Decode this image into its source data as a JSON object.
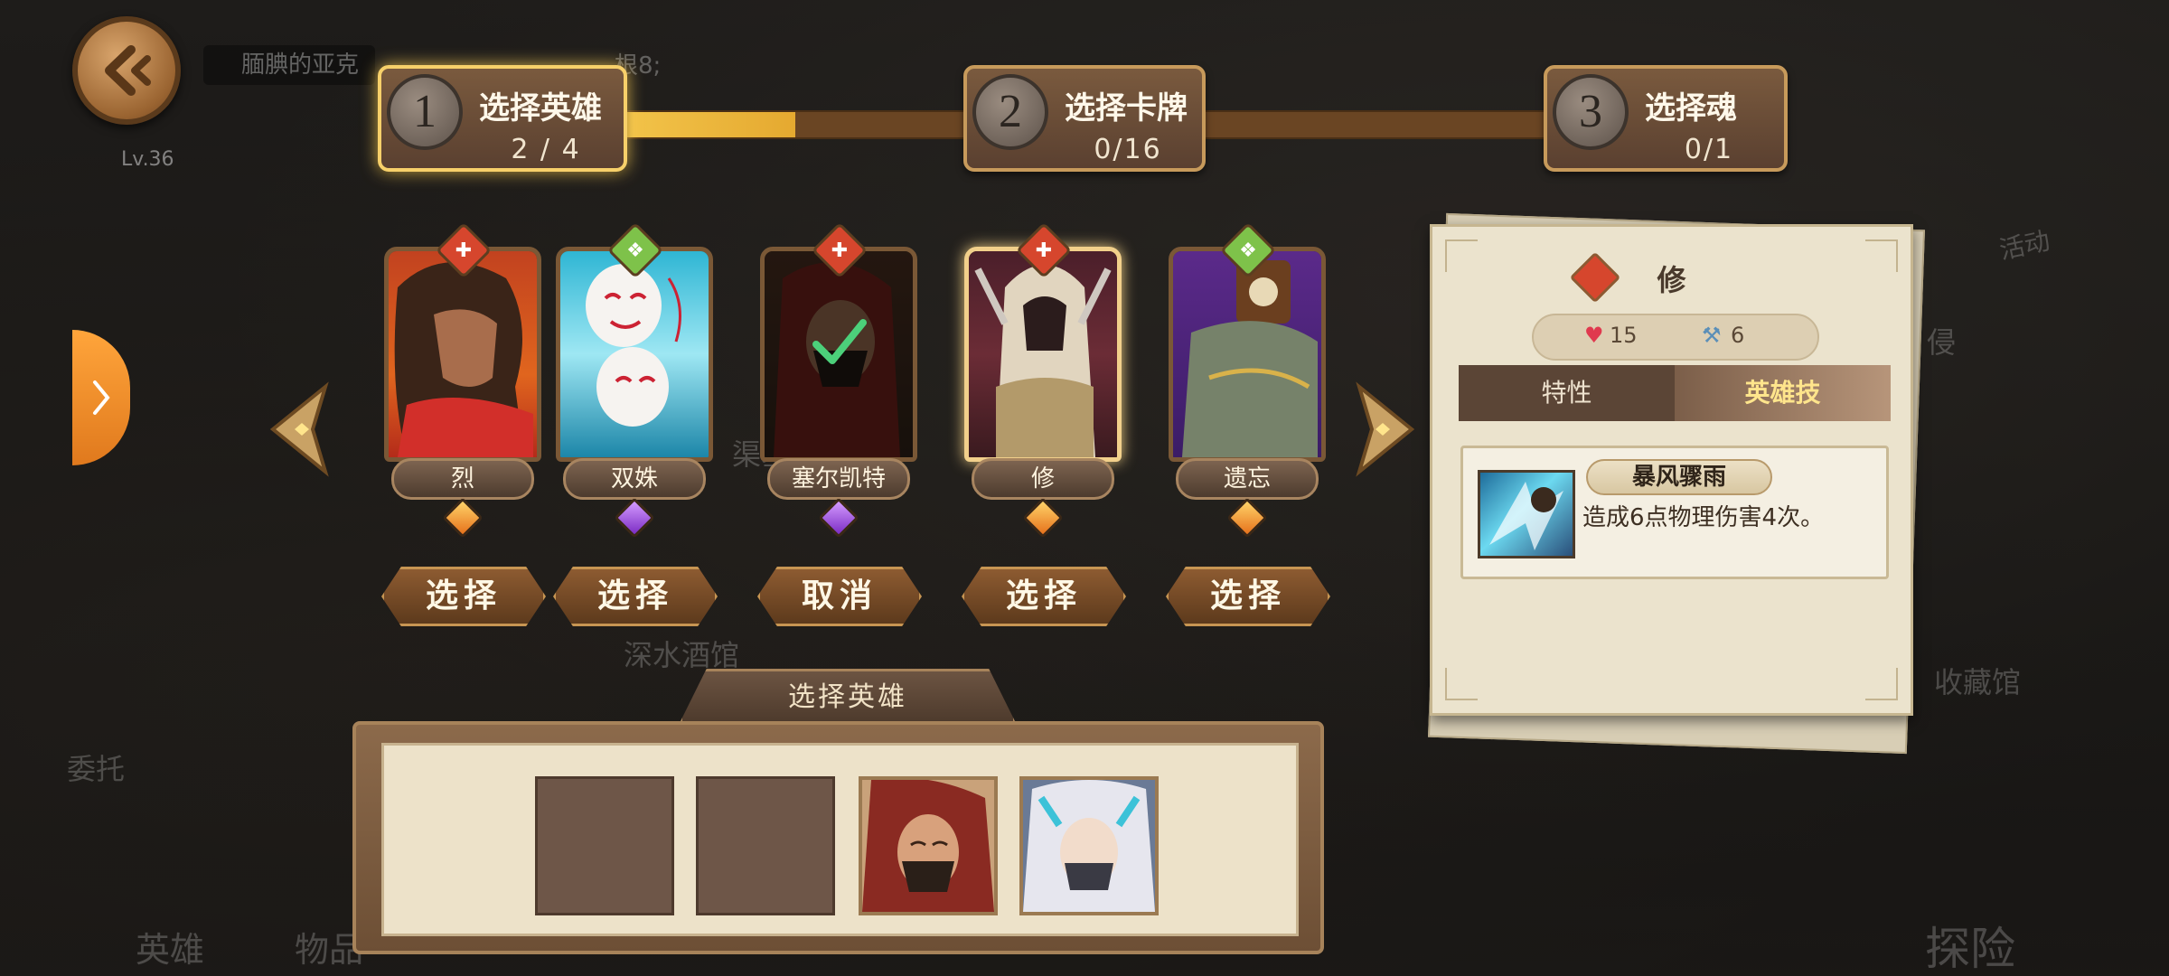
{
  "player": {
    "name": "腼腆的亚克",
    "level": "Lv.36"
  },
  "notice": "根8;",
  "background_labels": [
    "深水酒馆",
    "委托",
    "英雄",
    "物品",
    "侵",
    "活动",
    "收藏馆",
    "探险",
    "渠塞"
  ],
  "steps": [
    {
      "number": "1",
      "title": "选择英雄",
      "count": "2 / 4",
      "active": true
    },
    {
      "number": "2",
      "title": "选择卡牌",
      "count": "0/16",
      "active": false
    },
    {
      "number": "3",
      "title": "选择魂",
      "count": "0/1",
      "active": false
    }
  ],
  "heroes": [
    {
      "name": "烈",
      "class_icon": "sword-icon",
      "class_color": "#d6462d",
      "rarity": "orange",
      "action": "选择",
      "selected": false
    },
    {
      "name": "双姝",
      "class_icon": "shield-icon",
      "class_color": "#7ec24a",
      "rarity": "purple",
      "action": "选择",
      "selected": false
    },
    {
      "name": "塞尔凯特",
      "class_icon": "sword-icon",
      "class_color": "#d6462d",
      "rarity": "purple",
      "action": "取消",
      "selected": true
    },
    {
      "name": "修",
      "class_icon": "sword-icon",
      "class_color": "#d6462d",
      "rarity": "orange",
      "action": "选择",
      "selected": false
    },
    {
      "name": "遗忘",
      "class_icon": "shield-icon",
      "class_color": "#7ec24a",
      "rarity": "orange",
      "action": "选择",
      "selected": false
    }
  ],
  "pick_panel": {
    "title": "选择英雄",
    "slots": [
      "empty",
      "empty",
      "塞尔凯特",
      "silver-haired-hero"
    ]
  },
  "detail": {
    "hero_name": "修",
    "class_icon": "sword-icon",
    "hp": "15",
    "attack": "6",
    "tabs": [
      "特性",
      "英雄技"
    ],
    "active_tab": "英雄技",
    "skill": {
      "name": "暴风骤雨",
      "description": "造成6点物理伤害4次。"
    }
  },
  "colors": {
    "accent_gold": "#f3c54b",
    "track_brown": "#6a4523",
    "side_tab_orange": "#ffa53b"
  }
}
